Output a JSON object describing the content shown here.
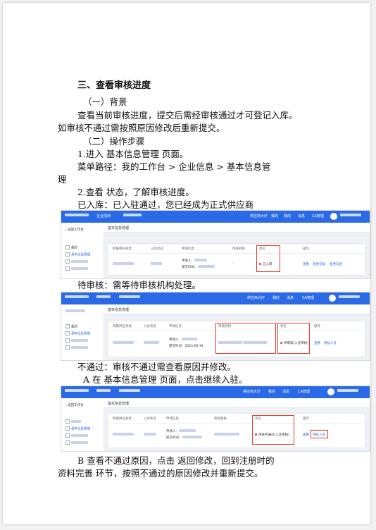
{
  "section_title": "三、查看审核进度",
  "background": {
    "heading": "（一）背景",
    "line1": "查看当前审核进度，提交后需经审核通过才可登记入库。",
    "line2": "如审核不通过需按照原因修改后重新提交。"
  },
  "steps": {
    "heading": "（二）操作步骤",
    "step1": "1.进入  基本信息管理  页面。",
    "path_line1": "菜单路径：我的工作台  >  企业信息  >  基本信息管",
    "path_line2": "理",
    "step2": "2.查看  状态，了解审核进度。",
    "stored": "已入库：已入驻通过，您已经成为正式供应商",
    "pending": "待审核：需等待审核机构处理。",
    "rejected": "不通过：审核不通过需查看原因并修改。",
    "rejected_a": "A 在  基本信息管理  页面，点击继续入驻。",
    "rejected_b1": "B 查看不通过原因，点击  返回修改，回到注册时的",
    "rejected_b2": "资料完善  环节，按照不通过的原因修改并重新提交。"
  },
  "screenshots": [
    {
      "top_nav": [
        "企业招商",
        "供应商大厅",
        "我的",
        "消息",
        "CA管理"
      ],
      "top_nav_extra": "我的",
      "sidebar": [
        "返回工作台",
        "我的",
        "基本信息管理"
      ],
      "crumb": "基本信息管理",
      "columns": [
        "所属供应商类",
        "入驻状态",
        "申请信息",
        "审核机构",
        "状态",
        "操作"
      ],
      "applicant_label": "申请人：",
      "date_label": "提交时间：",
      "dash": "-",
      "status": "已入库",
      "actions": [
        "查看",
        "变更记录",
        "变更信息"
      ]
    },
    {
      "top_nav": [
        "供应商大厅",
        "我的",
        "消息",
        "CA管理"
      ],
      "sidebar": [
        "我的",
        "基本信息管理"
      ],
      "crumb": "基本信息管理",
      "columns": [
        "所属供应商类",
        "入驻状态",
        "申请信息",
        "审核机构",
        "状态",
        "操作"
      ],
      "applicant_label": "申请人：",
      "date_label": "提交时间：",
      "date_value": "2024-06-18",
      "status": "待审核[入驻审核]",
      "actions": [
        "查看",
        "继续入驻"
      ]
    },
    {
      "top_nav": [
        "供应商大厅",
        "我的",
        "消息",
        "CA管理"
      ],
      "sidebar": [
        "返回工作台",
        "基本信息管理"
      ],
      "crumb": "基本信息管理",
      "columns": [
        "所属供应商类",
        "入驻状态",
        "申请信息",
        "审核机构",
        "状态",
        "操作"
      ],
      "applicant_label": "申请人：",
      "date_label": "提交时间：",
      "status": "审核不通过[入驻审核]",
      "actions": [
        "查看",
        "继续入驻"
      ]
    }
  ],
  "colors": {
    "topbar": "#2a6ae6",
    "highlight": "#e23b2e",
    "link": "#2a6ae6"
  }
}
